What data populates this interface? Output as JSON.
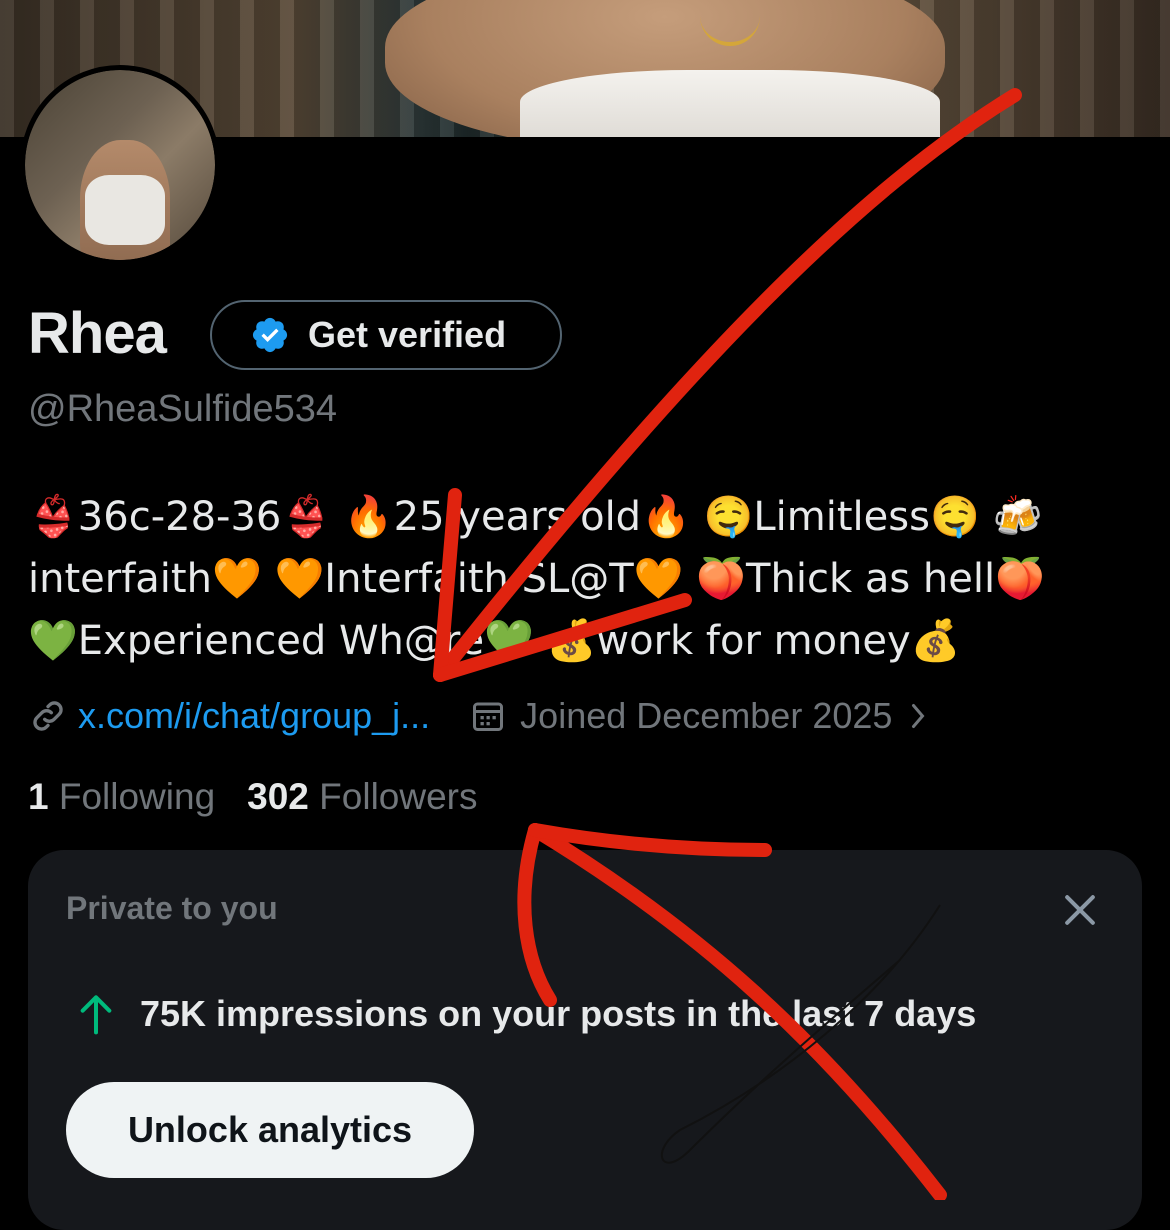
{
  "profile": {
    "name": "Rhea",
    "get_verified_label": "Get verified",
    "handle": "@RheaSulfide534",
    "bio_lines": [
      "👙36c-28-36👙  🔥25 years old🔥  🤤Limitless🤤  🍻",
      "interfaith🧡  🧡Interfaith SL@T🧡  🍑Thick as hell🍑",
      "💚Experienced Wh@re💚  💰work for money💰"
    ],
    "link_text": "x.com/i/chat/group_j...",
    "joined_text": "Joined December 2025",
    "following_count": "1",
    "following_label": "Following",
    "followers_count": "302",
    "followers_label": "Followers"
  },
  "analytics_card": {
    "title": "Private to you",
    "insight_text": "75K impressions on your posts in the last 7 days",
    "unlock_label": "Unlock analytics"
  },
  "icons": {
    "verified": "verified-badge-icon",
    "link": "link-icon",
    "calendar": "calendar-icon",
    "chevron": "chevron-right-icon",
    "close": "close-icon",
    "trend": "arrow-up-icon"
  },
  "colors": {
    "background": "#000000",
    "accent_blue": "#1d9bf0",
    "muted_text": "#71767b",
    "annotation_red": "#e0230f",
    "trend_green": "#00ba7c"
  }
}
